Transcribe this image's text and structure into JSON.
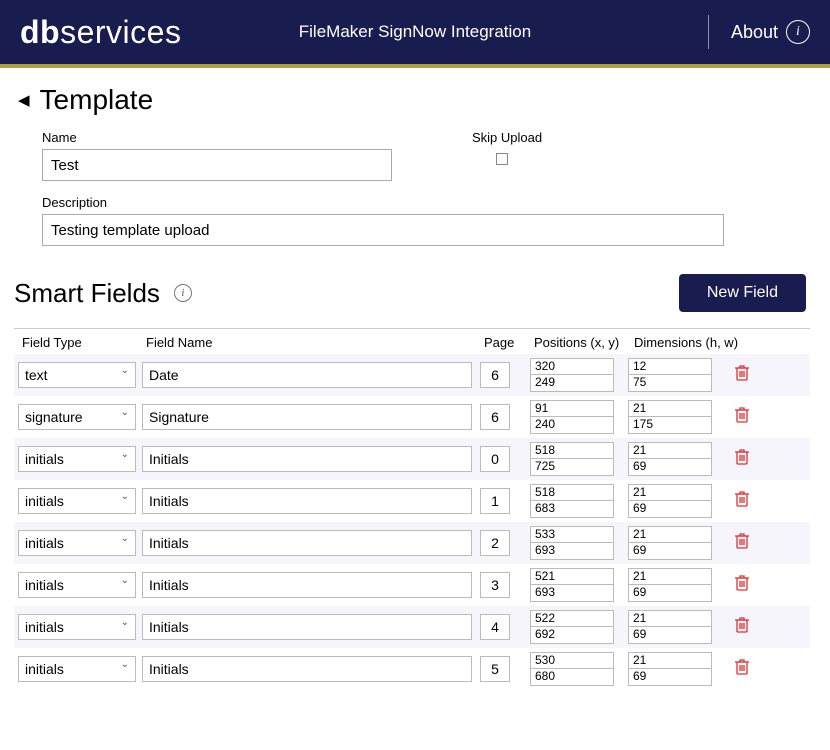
{
  "header": {
    "logo_bold": "db",
    "logo_light": "services",
    "title": "FileMaker SignNow Integration",
    "about": "About"
  },
  "page": {
    "title": "Template",
    "name_label": "Name",
    "name_value": "Test",
    "skip_label": "Skip Upload",
    "desc_label": "Description",
    "desc_value": "Testing template upload"
  },
  "smart": {
    "title": "Smart Fields",
    "new_field": "New Field",
    "col_type": "Field Type",
    "col_name": "Field Name",
    "col_page": "Page",
    "col_pos": "Positions (x, y)",
    "col_dim": "Dimensions (h, w)"
  },
  "rows": [
    {
      "type": "text",
      "name": "Date",
      "page": "6",
      "x": "320",
      "y": "249",
      "h": "12",
      "w": "75"
    },
    {
      "type": "signature",
      "name": "Signature",
      "page": "6",
      "x": "91",
      "y": "240",
      "h": "21",
      "w": "175"
    },
    {
      "type": "initials",
      "name": "Initials",
      "page": "0",
      "x": "518",
      "y": "725",
      "h": "21",
      "w": "69"
    },
    {
      "type": "initials",
      "name": "Initials",
      "page": "1",
      "x": "518",
      "y": "683",
      "h": "21",
      "w": "69"
    },
    {
      "type": "initials",
      "name": "Initials",
      "page": "2",
      "x": "533",
      "y": "693",
      "h": "21",
      "w": "69"
    },
    {
      "type": "initials",
      "name": "Initials",
      "page": "3",
      "x": "521",
      "y": "693",
      "h": "21",
      "w": "69"
    },
    {
      "type": "initials",
      "name": "Initials",
      "page": "4",
      "x": "522",
      "y": "692",
      "h": "21",
      "w": "69"
    },
    {
      "type": "initials",
      "name": "Initials",
      "page": "5",
      "x": "530",
      "y": "680",
      "h": "21",
      "w": "69"
    }
  ]
}
